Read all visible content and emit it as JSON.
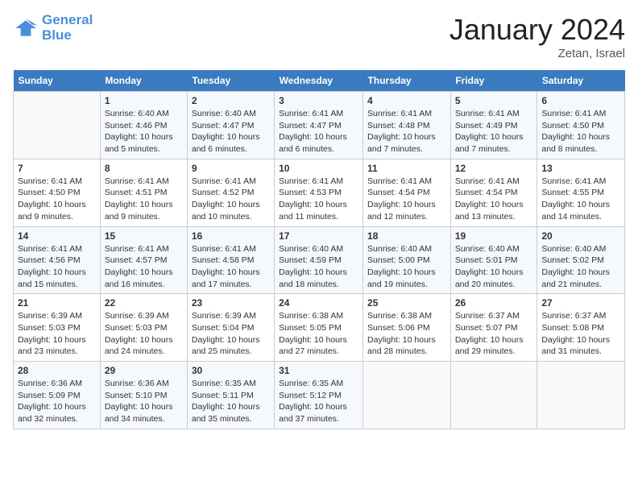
{
  "header": {
    "logo_line1": "General",
    "logo_line2": "Blue",
    "month": "January 2024",
    "location": "Zetan, Israel"
  },
  "weekdays": [
    "Sunday",
    "Monday",
    "Tuesday",
    "Wednesday",
    "Thursday",
    "Friday",
    "Saturday"
  ],
  "weeks": [
    [
      {
        "day": "",
        "sunrise": "",
        "sunset": "",
        "daylight": ""
      },
      {
        "day": "1",
        "sunrise": "Sunrise: 6:40 AM",
        "sunset": "Sunset: 4:46 PM",
        "daylight": "Daylight: 10 hours and 5 minutes."
      },
      {
        "day": "2",
        "sunrise": "Sunrise: 6:40 AM",
        "sunset": "Sunset: 4:47 PM",
        "daylight": "Daylight: 10 hours and 6 minutes."
      },
      {
        "day": "3",
        "sunrise": "Sunrise: 6:41 AM",
        "sunset": "Sunset: 4:47 PM",
        "daylight": "Daylight: 10 hours and 6 minutes."
      },
      {
        "day": "4",
        "sunrise": "Sunrise: 6:41 AM",
        "sunset": "Sunset: 4:48 PM",
        "daylight": "Daylight: 10 hours and 7 minutes."
      },
      {
        "day": "5",
        "sunrise": "Sunrise: 6:41 AM",
        "sunset": "Sunset: 4:49 PM",
        "daylight": "Daylight: 10 hours and 7 minutes."
      },
      {
        "day": "6",
        "sunrise": "Sunrise: 6:41 AM",
        "sunset": "Sunset: 4:50 PM",
        "daylight": "Daylight: 10 hours and 8 minutes."
      }
    ],
    [
      {
        "day": "7",
        "sunrise": "Sunrise: 6:41 AM",
        "sunset": "Sunset: 4:50 PM",
        "daylight": "Daylight: 10 hours and 9 minutes."
      },
      {
        "day": "8",
        "sunrise": "Sunrise: 6:41 AM",
        "sunset": "Sunset: 4:51 PM",
        "daylight": "Daylight: 10 hours and 9 minutes."
      },
      {
        "day": "9",
        "sunrise": "Sunrise: 6:41 AM",
        "sunset": "Sunset: 4:52 PM",
        "daylight": "Daylight: 10 hours and 10 minutes."
      },
      {
        "day": "10",
        "sunrise": "Sunrise: 6:41 AM",
        "sunset": "Sunset: 4:53 PM",
        "daylight": "Daylight: 10 hours and 11 minutes."
      },
      {
        "day": "11",
        "sunrise": "Sunrise: 6:41 AM",
        "sunset": "Sunset: 4:54 PM",
        "daylight": "Daylight: 10 hours and 12 minutes."
      },
      {
        "day": "12",
        "sunrise": "Sunrise: 6:41 AM",
        "sunset": "Sunset: 4:54 PM",
        "daylight": "Daylight: 10 hours and 13 minutes."
      },
      {
        "day": "13",
        "sunrise": "Sunrise: 6:41 AM",
        "sunset": "Sunset: 4:55 PM",
        "daylight": "Daylight: 10 hours and 14 minutes."
      }
    ],
    [
      {
        "day": "14",
        "sunrise": "Sunrise: 6:41 AM",
        "sunset": "Sunset: 4:56 PM",
        "daylight": "Daylight: 10 hours and 15 minutes."
      },
      {
        "day": "15",
        "sunrise": "Sunrise: 6:41 AM",
        "sunset": "Sunset: 4:57 PM",
        "daylight": "Daylight: 10 hours and 16 minutes."
      },
      {
        "day": "16",
        "sunrise": "Sunrise: 6:41 AM",
        "sunset": "Sunset: 4:58 PM",
        "daylight": "Daylight: 10 hours and 17 minutes."
      },
      {
        "day": "17",
        "sunrise": "Sunrise: 6:40 AM",
        "sunset": "Sunset: 4:59 PM",
        "daylight": "Daylight: 10 hours and 18 minutes."
      },
      {
        "day": "18",
        "sunrise": "Sunrise: 6:40 AM",
        "sunset": "Sunset: 5:00 PM",
        "daylight": "Daylight: 10 hours and 19 minutes."
      },
      {
        "day": "19",
        "sunrise": "Sunrise: 6:40 AM",
        "sunset": "Sunset: 5:01 PM",
        "daylight": "Daylight: 10 hours and 20 minutes."
      },
      {
        "day": "20",
        "sunrise": "Sunrise: 6:40 AM",
        "sunset": "Sunset: 5:02 PM",
        "daylight": "Daylight: 10 hours and 21 minutes."
      }
    ],
    [
      {
        "day": "21",
        "sunrise": "Sunrise: 6:39 AM",
        "sunset": "Sunset: 5:03 PM",
        "daylight": "Daylight: 10 hours and 23 minutes."
      },
      {
        "day": "22",
        "sunrise": "Sunrise: 6:39 AM",
        "sunset": "Sunset: 5:03 PM",
        "daylight": "Daylight: 10 hours and 24 minutes."
      },
      {
        "day": "23",
        "sunrise": "Sunrise: 6:39 AM",
        "sunset": "Sunset: 5:04 PM",
        "daylight": "Daylight: 10 hours and 25 minutes."
      },
      {
        "day": "24",
        "sunrise": "Sunrise: 6:38 AM",
        "sunset": "Sunset: 5:05 PM",
        "daylight": "Daylight: 10 hours and 27 minutes."
      },
      {
        "day": "25",
        "sunrise": "Sunrise: 6:38 AM",
        "sunset": "Sunset: 5:06 PM",
        "daylight": "Daylight: 10 hours and 28 minutes."
      },
      {
        "day": "26",
        "sunrise": "Sunrise: 6:37 AM",
        "sunset": "Sunset: 5:07 PM",
        "daylight": "Daylight: 10 hours and 29 minutes."
      },
      {
        "day": "27",
        "sunrise": "Sunrise: 6:37 AM",
        "sunset": "Sunset: 5:08 PM",
        "daylight": "Daylight: 10 hours and 31 minutes."
      }
    ],
    [
      {
        "day": "28",
        "sunrise": "Sunrise: 6:36 AM",
        "sunset": "Sunset: 5:09 PM",
        "daylight": "Daylight: 10 hours and 32 minutes."
      },
      {
        "day": "29",
        "sunrise": "Sunrise: 6:36 AM",
        "sunset": "Sunset: 5:10 PM",
        "daylight": "Daylight: 10 hours and 34 minutes."
      },
      {
        "day": "30",
        "sunrise": "Sunrise: 6:35 AM",
        "sunset": "Sunset: 5:11 PM",
        "daylight": "Daylight: 10 hours and 35 minutes."
      },
      {
        "day": "31",
        "sunrise": "Sunrise: 6:35 AM",
        "sunset": "Sunset: 5:12 PM",
        "daylight": "Daylight: 10 hours and 37 minutes."
      },
      {
        "day": "",
        "sunrise": "",
        "sunset": "",
        "daylight": ""
      },
      {
        "day": "",
        "sunrise": "",
        "sunset": "",
        "daylight": ""
      },
      {
        "day": "",
        "sunrise": "",
        "sunset": "",
        "daylight": ""
      }
    ]
  ]
}
